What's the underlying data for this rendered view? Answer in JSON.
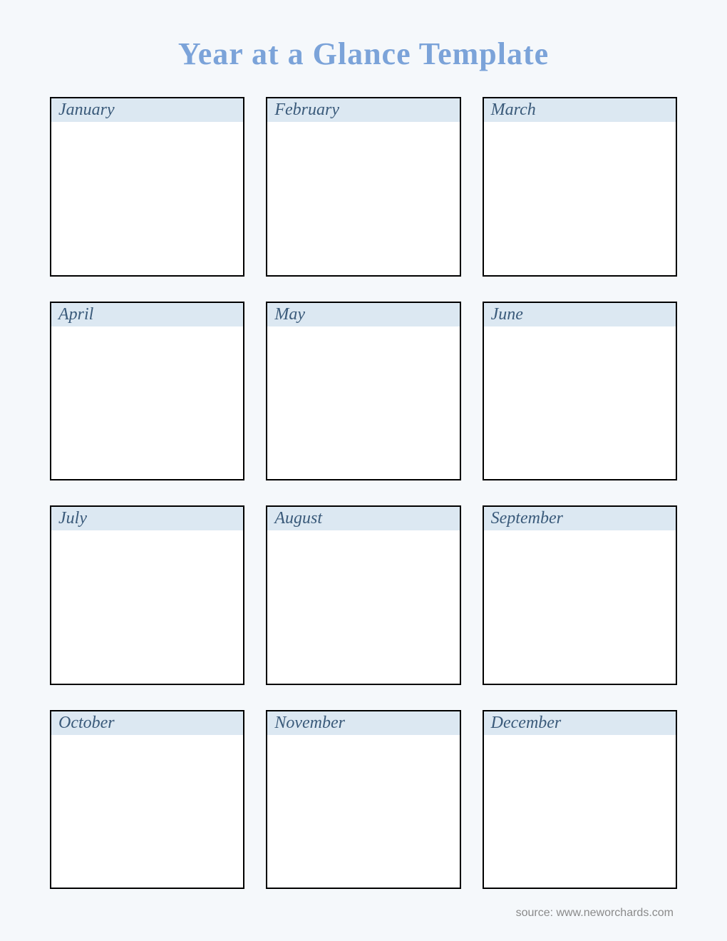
{
  "title": "Year at a Glance Template",
  "months": [
    "January",
    "February",
    "March",
    "April",
    "May",
    "June",
    "July",
    "August",
    "September",
    "October",
    "November",
    "December"
  ],
  "footer": "source: www.neworchards.com"
}
